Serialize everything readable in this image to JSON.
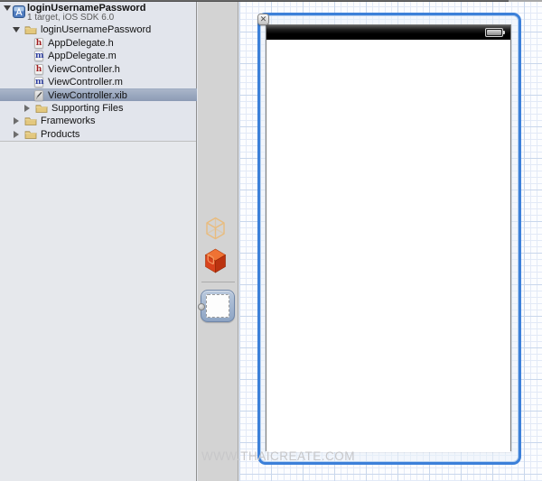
{
  "navigator": {
    "project": {
      "name": "loginUsernamePassword",
      "subtitle": "1 target, iOS SDK 6.0"
    },
    "items": [
      {
        "label": "loginUsernamePassword",
        "type": "folder",
        "expanded": true,
        "selected": false
      },
      {
        "label": "AppDelegate.h",
        "type": "file-h",
        "selected": false
      },
      {
        "label": "AppDelegate.m",
        "type": "file-m",
        "selected": false
      },
      {
        "label": "ViewController.h",
        "type": "file-h",
        "selected": false
      },
      {
        "label": "ViewController.m",
        "type": "file-m",
        "selected": false
      },
      {
        "label": "ViewController.xib",
        "type": "file-xib",
        "selected": true
      },
      {
        "label": "Supporting Files",
        "type": "folder",
        "expanded": false,
        "selected": false
      },
      {
        "label": "Frameworks",
        "type": "folder",
        "expanded": false,
        "selected": false
      },
      {
        "label": "Products",
        "type": "folder",
        "expanded": false,
        "selected": false
      }
    ],
    "file_icon_letters": {
      "header": "h",
      "implementation": "m"
    }
  },
  "dock": {
    "objects": [
      {
        "name": "files-owner-placeholder-cube"
      },
      {
        "name": "first-responder-cube"
      },
      {
        "name": "view-object",
        "selected": true
      }
    ]
  },
  "canvas": {
    "close_glyph": "✕",
    "watermark": "WWW.THAICREATE.COM",
    "view": {
      "status_bar": "black",
      "background": "white",
      "content": ""
    }
  },
  "colors": {
    "selection_frame_blue": "#3c80d9",
    "nav_row_selection_top": "#a9b5c9",
    "nav_row_selection_bottom": "#8c9bb5",
    "navigator_bg": "#e2e5ec",
    "dock_bg": "#d3d3d3",
    "grid_minor": "#e3eaf7",
    "grid_major": "#c9d7ec",
    "folder_yellow": "#e3c87e",
    "cube_orange": "#d9431c",
    "header_letter_red": "#9e1b1e",
    "implementation_letter_blue": "#2e3f9f"
  }
}
